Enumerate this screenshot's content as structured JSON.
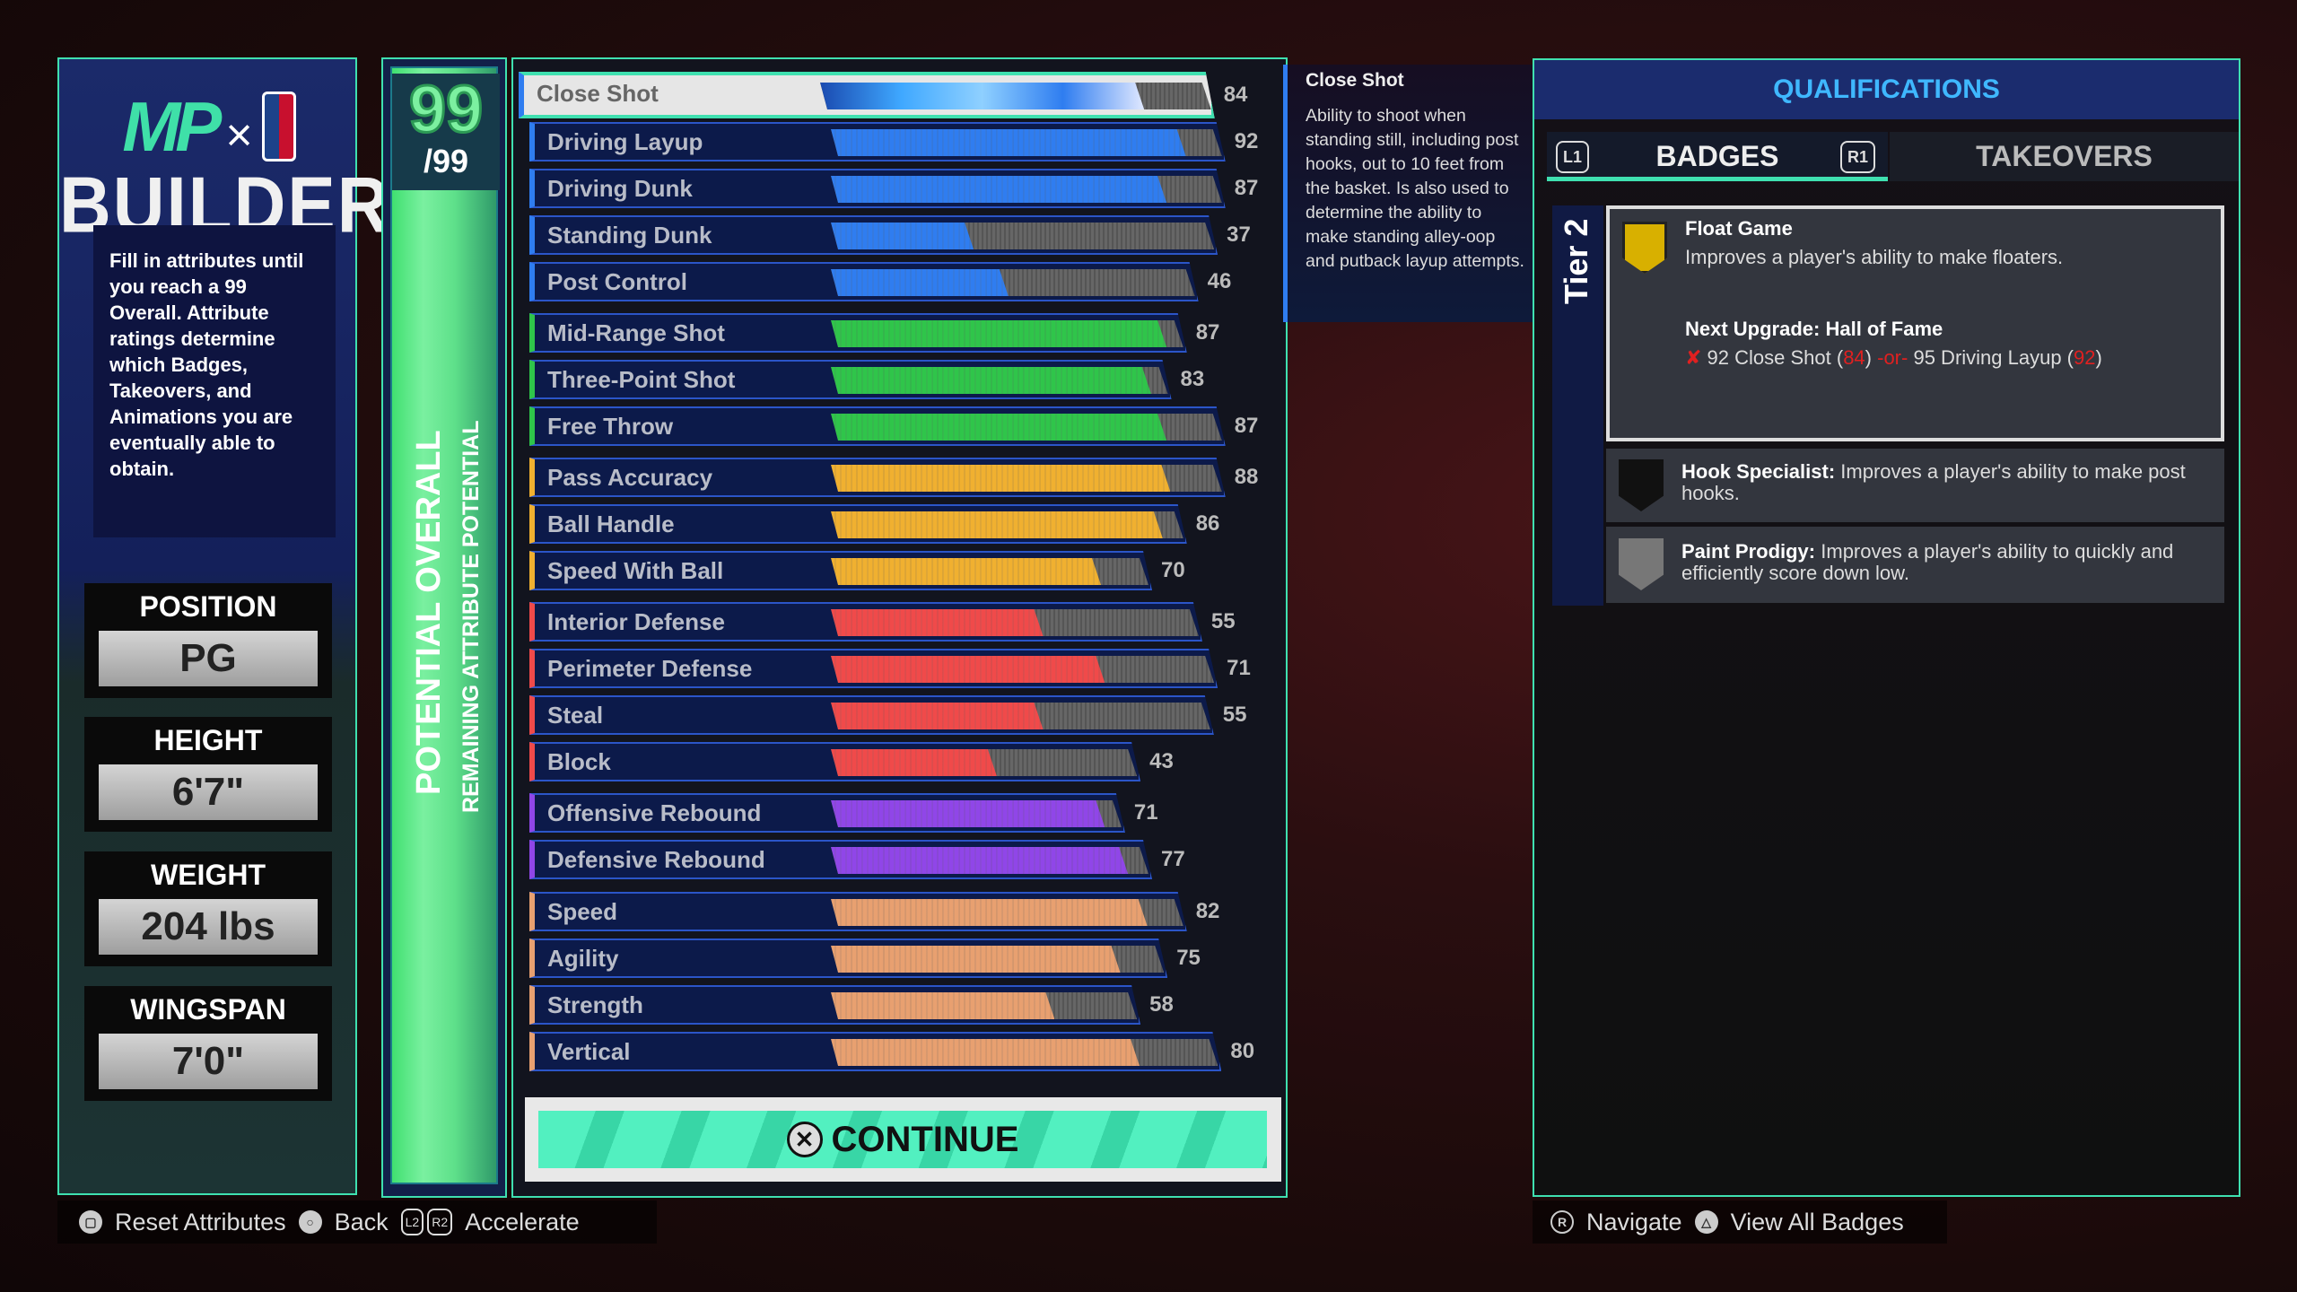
{
  "logo": {
    "brand": "MP",
    "cross": "×",
    "title": "BUILDER"
  },
  "intro": "Fill in attributes until you reach a 99 Overall. Attribute ratings determine which Badges, Takeovers, and Animations you are eventually able to obtain.",
  "profile": [
    {
      "label": "POSITION",
      "value": "PG"
    },
    {
      "label": "HEIGHT",
      "value": "6'7\""
    },
    {
      "label": "WEIGHT",
      "value": "204 lbs"
    },
    {
      "label": "WINGSPAN",
      "value": "7'0\""
    }
  ],
  "potential": {
    "overall": "99",
    "max": "/99",
    "label1": "POTENTIAL OVERALL",
    "label2": "REMAINING ATTRIBUTE POTENTIAL"
  },
  "colors": {
    "finishing": "#2f7df0",
    "shooting": "#2fc54a",
    "playmaking": "#f0b030",
    "defense": "#f04a4a",
    "rebounding": "#9046e8",
    "physicals": "#e8a070",
    "accent": "#3fe0b0"
  },
  "attributes": [
    {
      "name": "Close Shot",
      "value": 84,
      "cap": 99,
      "group": "finishing",
      "selected": true
    },
    {
      "name": "Driving Layup",
      "value": 92,
      "cap": 99,
      "group": "finishing"
    },
    {
      "name": "Driving Dunk",
      "value": 87,
      "cap": 99,
      "group": "finishing"
    },
    {
      "name": "Standing Dunk",
      "value": 37,
      "cap": 97,
      "group": "finishing"
    },
    {
      "name": "Post Control",
      "value": 46,
      "cap": 92,
      "group": "finishing"
    },
    {
      "name": "Mid-Range Shot",
      "value": 87,
      "cap": 89,
      "group": "shooting"
    },
    {
      "name": "Three-Point Shot",
      "value": 83,
      "cap": 85,
      "group": "shooting"
    },
    {
      "name": "Free Throw",
      "value": 87,
      "cap": 99,
      "group": "shooting"
    },
    {
      "name": "Pass Accuracy",
      "value": 88,
      "cap": 99,
      "group": "playmaking"
    },
    {
      "name": "Ball Handle",
      "value": 86,
      "cap": 89,
      "group": "playmaking"
    },
    {
      "name": "Speed With Ball",
      "value": 70,
      "cap": 80,
      "group": "playmaking"
    },
    {
      "name": "Interior Defense",
      "value": 55,
      "cap": 93,
      "group": "defense"
    },
    {
      "name": "Perimeter Defense",
      "value": 71,
      "cap": 97,
      "group": "defense"
    },
    {
      "name": "Steal",
      "value": 55,
      "cap": 96,
      "group": "defense"
    },
    {
      "name": "Block",
      "value": 43,
      "cap": 77,
      "group": "defense"
    },
    {
      "name": "Offensive Rebound",
      "value": 71,
      "cap": 73,
      "group": "rebounding"
    },
    {
      "name": "Defensive Rebound",
      "value": 77,
      "cap": 80,
      "group": "rebounding"
    },
    {
      "name": "Speed",
      "value": 82,
      "cap": 89,
      "group": "physicals"
    },
    {
      "name": "Agility",
      "value": 75,
      "cap": 84,
      "group": "physicals"
    },
    {
      "name": "Strength",
      "value": 58,
      "cap": 77,
      "group": "physicals"
    },
    {
      "name": "Vertical",
      "value": 80,
      "cap": 98,
      "group": "physicals"
    }
  ],
  "continue_label": "CONTINUE",
  "tooltip": {
    "title": "Close Shot",
    "body": "Ability to shoot when standing still, including post hooks, out to 10 feet from the basket. Is also used to determine the ability to make standing alley-oop and putback layup attempts."
  },
  "qualifications": {
    "title": "QUALIFICATIONS",
    "tabs": [
      {
        "label": "BADGES",
        "active": true
      },
      {
        "label": "TAKEOVERS",
        "active": false
      }
    ],
    "l1": "L1",
    "r1": "R1",
    "tier": "Tier 2",
    "selected_badge": {
      "name": "Float Game",
      "desc": "Improves a player's ability to make floaters.",
      "next_upgrade": "Next Upgrade: Hall of Fame",
      "req1": "92 Close Shot (",
      "req1_cur": "84",
      "req_or": "-or-",
      "req2": "95 Driving Layup (",
      "req2_cur": "92",
      "close": ")"
    },
    "badges": [
      {
        "name": "Hook Specialist:",
        "desc": "Improves a player's ability to make post hooks."
      },
      {
        "name": "Paint Prodigy:",
        "desc": "Improves a player's ability to quickly and efficiently score down low."
      }
    ]
  },
  "footer_left": [
    {
      "icon": "square",
      "label": "Reset Attributes"
    },
    {
      "icon": "circle",
      "label": "Back"
    },
    {
      "icon": "L2 R2",
      "label": "Accelerate"
    }
  ],
  "footer_right": [
    {
      "icon": "R",
      "label": "Navigate"
    },
    {
      "icon": "triangle",
      "label": "View All Badges"
    }
  ]
}
